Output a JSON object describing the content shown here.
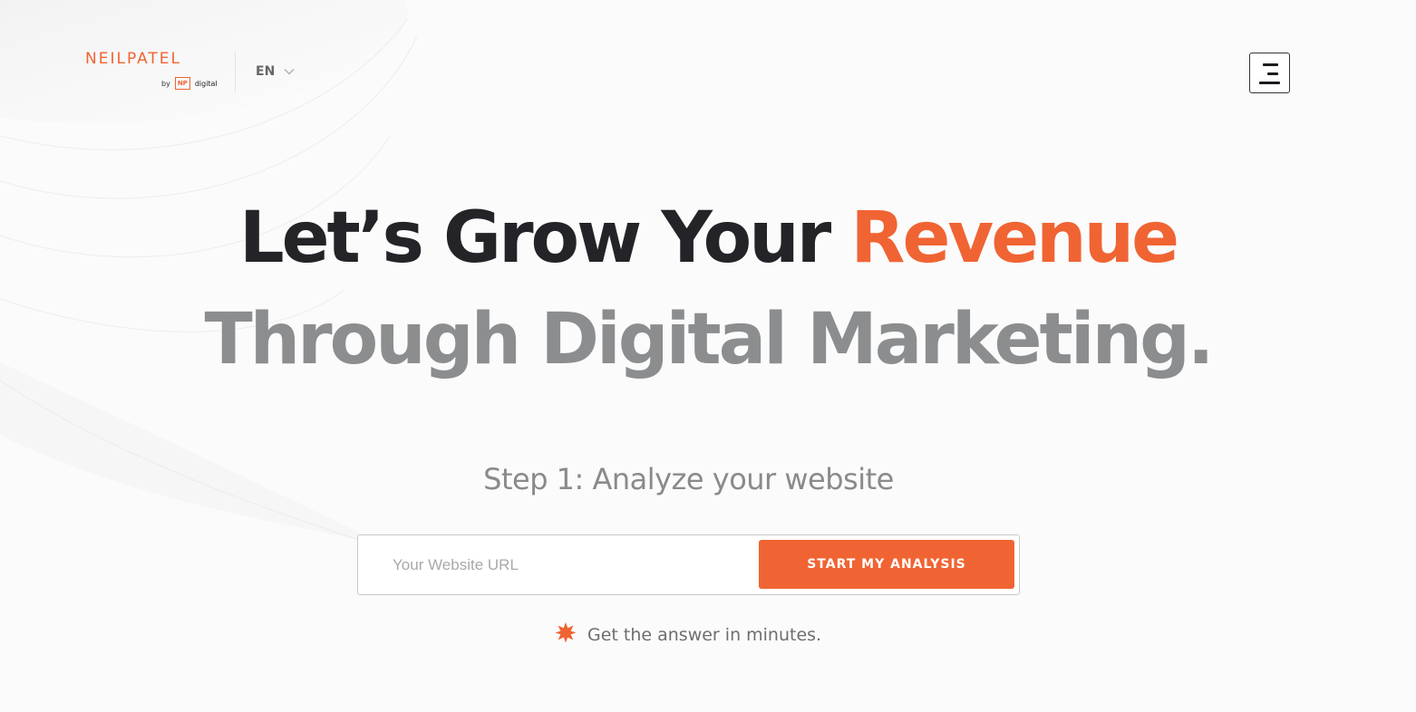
{
  "colors": {
    "accent": "#f06433",
    "headline_dark": "#232328",
    "headline_gray": "#8b8d8f",
    "button_text": "#ffffff"
  },
  "header": {
    "logo": {
      "name": "NEILPATEL",
      "by": "by",
      "np": "NP",
      "digital": "digital"
    },
    "language": {
      "label": "EN",
      "icon": "chevron-down-icon"
    },
    "menu_icon": "hamburger-menu-icon"
  },
  "hero": {
    "headline_line1_prefix": "Let’s Grow Your ",
    "headline_line1_accent": "Revenue",
    "headline_line2": "Through Digital Marketing.",
    "step_label": "Step 1: Analyze your website"
  },
  "form": {
    "url_placeholder": "Your Website URL",
    "url_value": "",
    "submit_label": "START MY ANALYSIS"
  },
  "note": {
    "icon": "starburst-icon",
    "text": "Get the answer in minutes."
  }
}
